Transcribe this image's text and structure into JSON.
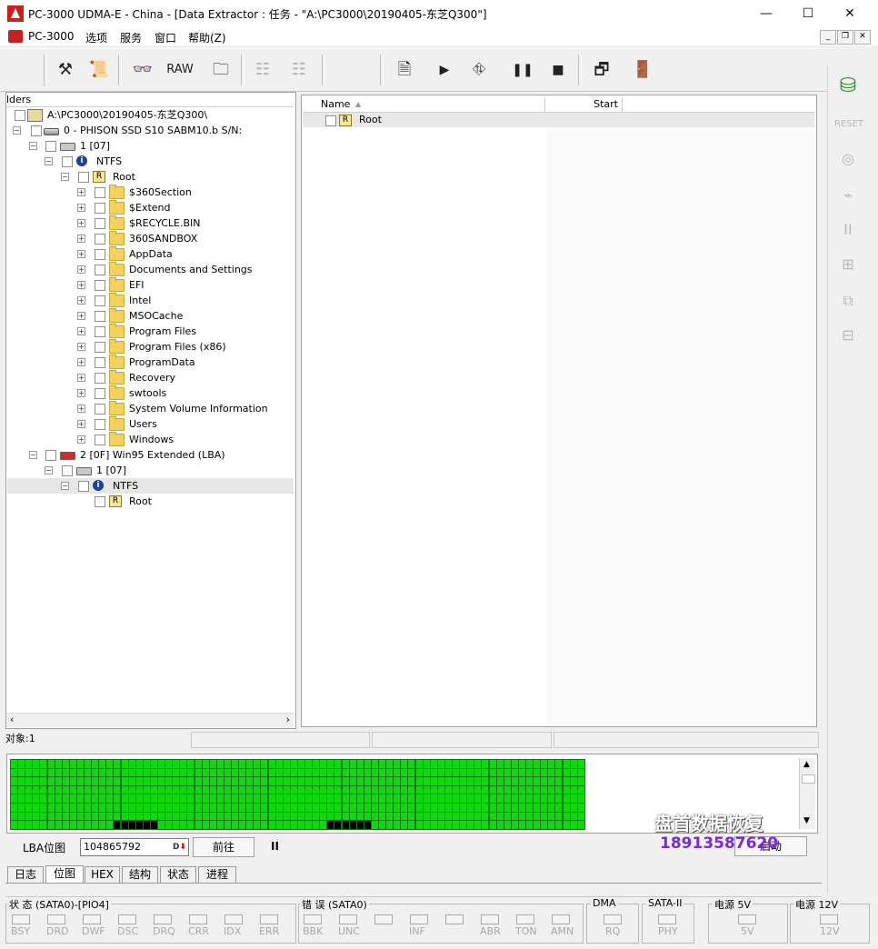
{
  "window": {
    "title": "PC-3000 UDMA-E - China - [Data Extractor : 任务 - \"A:\\PC3000\\20190405-东芝Q300\"]",
    "minimize": "—",
    "maximize": "☐",
    "close": "✕"
  },
  "menu": {
    "app": "PC-3000",
    "options": "选项",
    "service": "服务",
    "window": "窗口",
    "help": "帮助(Z)"
  },
  "toolbar": {
    "raw_label": "RAW"
  },
  "tree": {
    "header": "lders",
    "rows": [
      {
        "label": "A:\\PC3000\\20190405-东芝Q300\\"
      },
      {
        "label": "0 - PHISON SSD S10 SABM10.b S/N:"
      },
      {
        "label": "1 [07]"
      },
      {
        "label": "NTFS"
      },
      {
        "label": "Root"
      },
      {
        "label": "$360Section"
      },
      {
        "label": "$Extend"
      },
      {
        "label": "$RECYCLE.BIN"
      },
      {
        "label": "360SANDBOX"
      },
      {
        "label": "AppData"
      },
      {
        "label": "Documents and Settings"
      },
      {
        "label": "EFI"
      },
      {
        "label": "Intel"
      },
      {
        "label": "MSOCache"
      },
      {
        "label": "Program Files"
      },
      {
        "label": "Program Files (x86)"
      },
      {
        "label": "ProgramData"
      },
      {
        "label": "Recovery"
      },
      {
        "label": "swtools"
      },
      {
        "label": "System Volume Information"
      },
      {
        "label": "Users"
      },
      {
        "label": "Windows"
      },
      {
        "label": "2 [0F] Win95 Extended  (LBA)"
      },
      {
        "label": "1 [07]"
      },
      {
        "label": "NTFS"
      },
      {
        "label": "Root"
      }
    ]
  },
  "list": {
    "col_name": "Name",
    "col_start": "Start",
    "rows": [
      {
        "name": "Root"
      }
    ]
  },
  "status_strip": {
    "objects": "对象:1"
  },
  "map": {
    "lba_label": "LBA位图",
    "lba_value": "104865792",
    "forward_button": "前往",
    "pause_icon": "II",
    "start_button": "启动"
  },
  "tabs": [
    "日志",
    "位图",
    "HEX",
    "结构",
    "状态",
    "进程"
  ],
  "status_panel": {
    "state_group": "状 态 (SATA0)-[PIO4]",
    "state_leds": [
      "BSY",
      "DRD",
      "DWF",
      "DSC",
      "DRQ",
      "CRR",
      "IDX",
      "ERR"
    ],
    "error_group": "错 误 (SATA0)",
    "error_leds": [
      "BBK",
      "UNC",
      "",
      "INF",
      "",
      "ABR",
      "TON",
      "AMN"
    ],
    "dma_group": "DMA",
    "dma_led": "RQ",
    "sata_group": "SATA-II",
    "sata_led": "PHY",
    "p5_group": "电源 5V",
    "p5_led": "5V",
    "p12_group": "电源 12V",
    "p12_led": "12V"
  },
  "watermark": {
    "text": "盘首数据恢复",
    "phone": "18913587620"
  }
}
